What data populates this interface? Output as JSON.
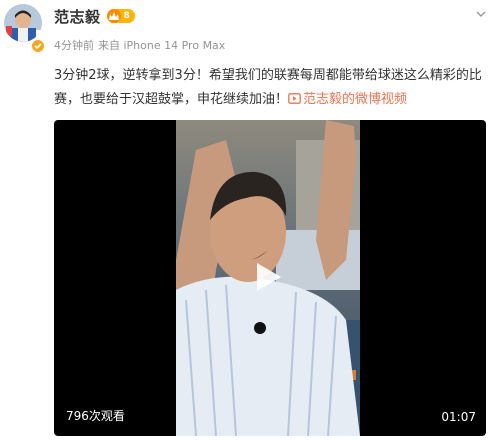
{
  "post": {
    "author": {
      "name": "范志毅",
      "vip_level": "8"
    },
    "meta": {
      "time": "4分钟前",
      "source": "来自 iPhone 14 Pro Max"
    },
    "text": "3分钟2球，逆转拿到3分！希望我们的联赛每周都能带给球迷这么精彩的比赛，也要给于汉超鼓掌，申花继续加油！",
    "video_link_label": "范志毅的微博视频",
    "video": {
      "views": "796次观看",
      "duration": "01:07"
    }
  },
  "colors": {
    "link": "#eb7350",
    "meta": "#939393",
    "video_bg": "#000000",
    "vip_badge": "#ffb400",
    "verify_badge": "#f6a623"
  },
  "icons": [
    "avatar",
    "verified-icon",
    "vip-crown-icon",
    "chevron-down-icon",
    "video-link-icon",
    "play-icon"
  ]
}
